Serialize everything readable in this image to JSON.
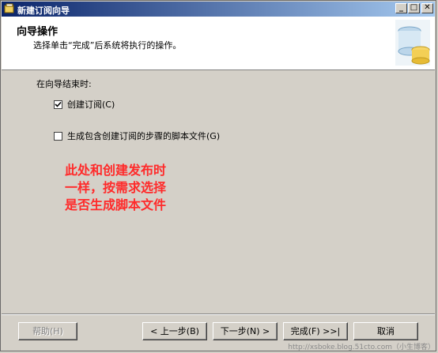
{
  "window": {
    "title": "新建订阅向导",
    "controls": {
      "minimize": "_",
      "maximize": "□",
      "close": "✕"
    }
  },
  "header": {
    "title": "向导操作",
    "subtitle": "选择单击“完成”后系统将执行的操作。"
  },
  "content": {
    "when_label": "在向导结束时:",
    "options": [
      {
        "label": "创建订阅(C)",
        "checked": true
      },
      {
        "label": "生成包含创建订阅的步骤的脚本文件(G)",
        "checked": false
      }
    ],
    "annotation_lines": [
      "此处和创建发布时",
      "一样，按需求选择",
      "是否生成脚本文件"
    ]
  },
  "buttons": {
    "help": "帮助(H)",
    "back": "< 上一步(B)",
    "next": "下一步(N) >",
    "finish": "完成(F) >>|",
    "cancel": "取消"
  },
  "watermark": "http://xsboke.blog.51cto.com（小生博客）"
}
